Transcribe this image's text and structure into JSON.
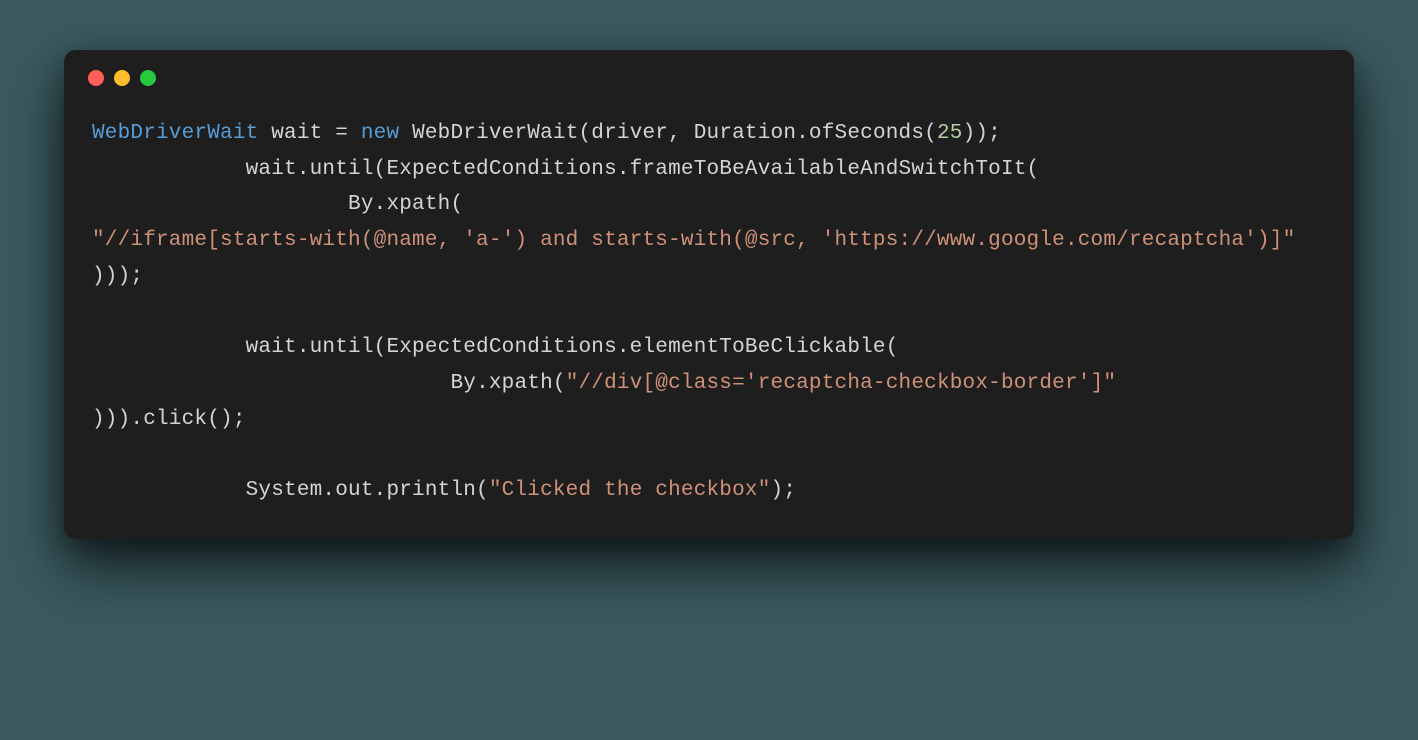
{
  "code": {
    "tokens": [
      {
        "t": "type",
        "v": "WebDriverWait"
      },
      {
        "t": "plain",
        "v": " wait = "
      },
      {
        "t": "keyword",
        "v": "new"
      },
      {
        "t": "plain",
        "v": " WebDriverWait(driver, Duration.ofSeconds("
      },
      {
        "t": "number",
        "v": "25"
      },
      {
        "t": "plain",
        "v": "));\n            wait.until(ExpectedConditions.frameToBeAvailableAndSwitchToIt(\n                    By.xpath(\n"
      },
      {
        "t": "string",
        "v": "\"//iframe[starts-with(@name, 'a-') and starts-with(@src, 'https://www.google.com/recaptcha')]\""
      },
      {
        "t": "plain",
        "v": "\n)));\n\n            wait.until(ExpectedConditions.elementToBeClickable(\n                            By.xpath("
      },
      {
        "t": "string",
        "v": "\"//div[@class='recaptcha-checkbox-border']\""
      },
      {
        "t": "plain",
        "v": "\n))).click();\n\n            System.out.println("
      },
      {
        "t": "string",
        "v": "\"Clicked the checkbox\""
      },
      {
        "t": "plain",
        "v": ");"
      }
    ]
  }
}
